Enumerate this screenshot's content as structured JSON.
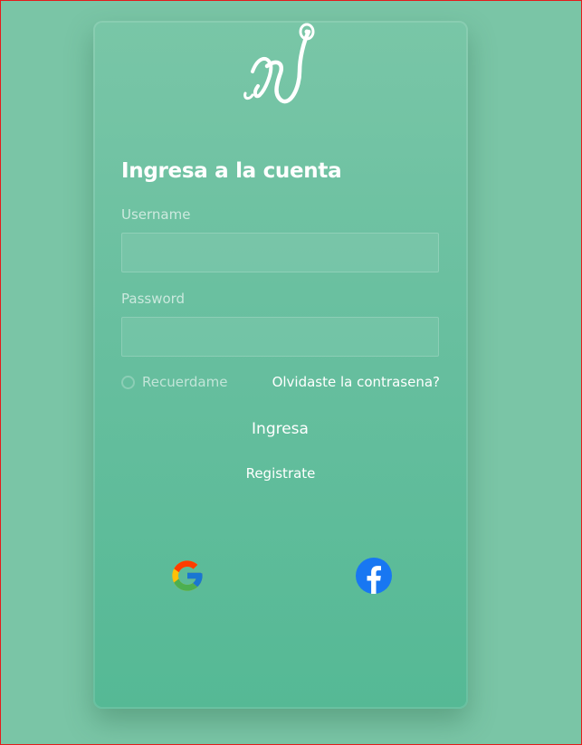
{
  "login": {
    "title": "Ingresa a la cuenta",
    "username_label": "Username",
    "username_value": "",
    "password_label": "Password",
    "password_value": "",
    "remember_label": "Recuerdame",
    "forgot_label": "Olvidaste la contrasena?",
    "submit_label": "Ingresa",
    "register_label": "Registrate"
  },
  "social": {
    "google_icon": "google-icon",
    "facebook_icon": "facebook-icon"
  },
  "colors": {
    "background": "#7ac5a6",
    "card_top": "#79c6a7",
    "card_bottom": "#55b995",
    "facebook": "#1877f2",
    "frame_border": "#e51b1b"
  }
}
